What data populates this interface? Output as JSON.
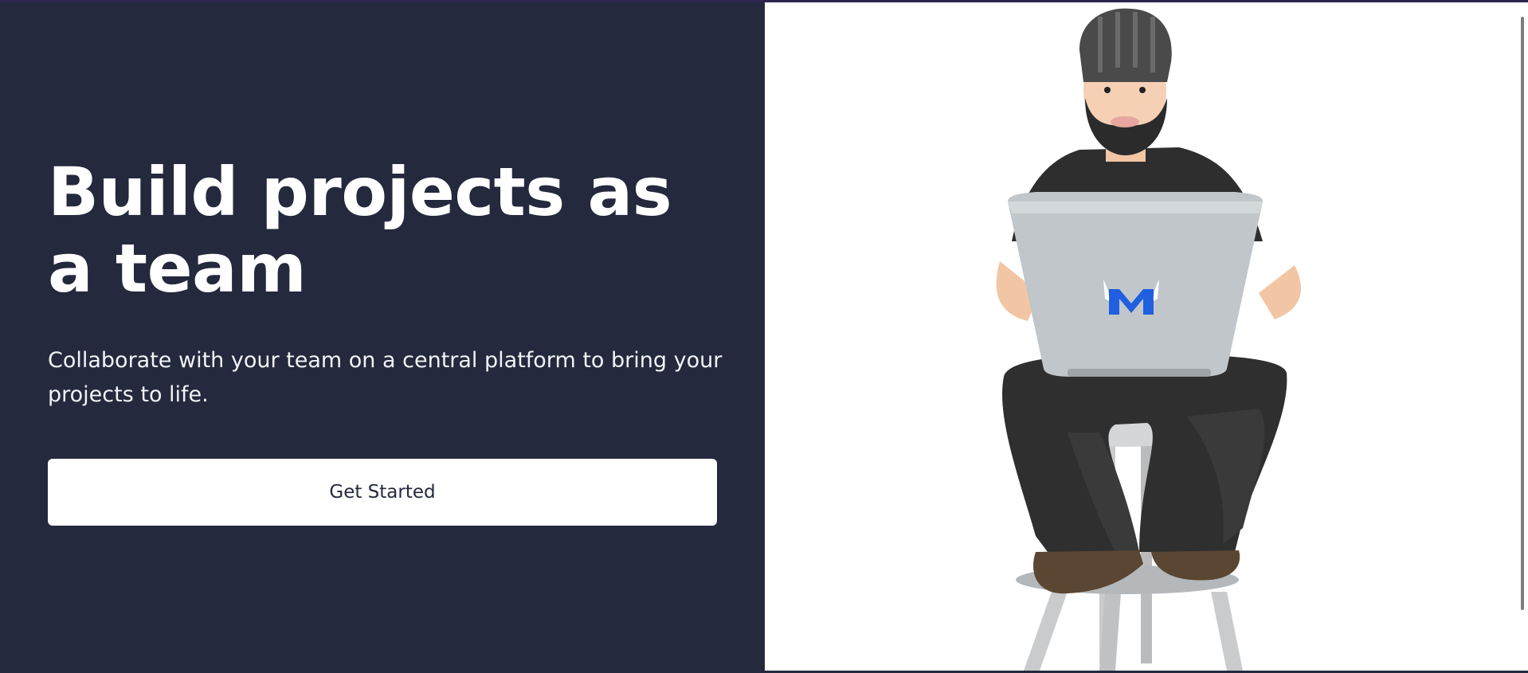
{
  "hero": {
    "title": "Build projects as a team",
    "subtitle": "Collaborate with your team on a central platform to bring your projects to life.",
    "cta_label": "Get Started"
  },
  "illustration": {
    "subject": "person-with-laptop",
    "laptop_logo": "logo-icon"
  },
  "colors": {
    "left_background": "#24293d",
    "right_background": "#ffffff",
    "logo_blue": "#1f5fe0"
  }
}
